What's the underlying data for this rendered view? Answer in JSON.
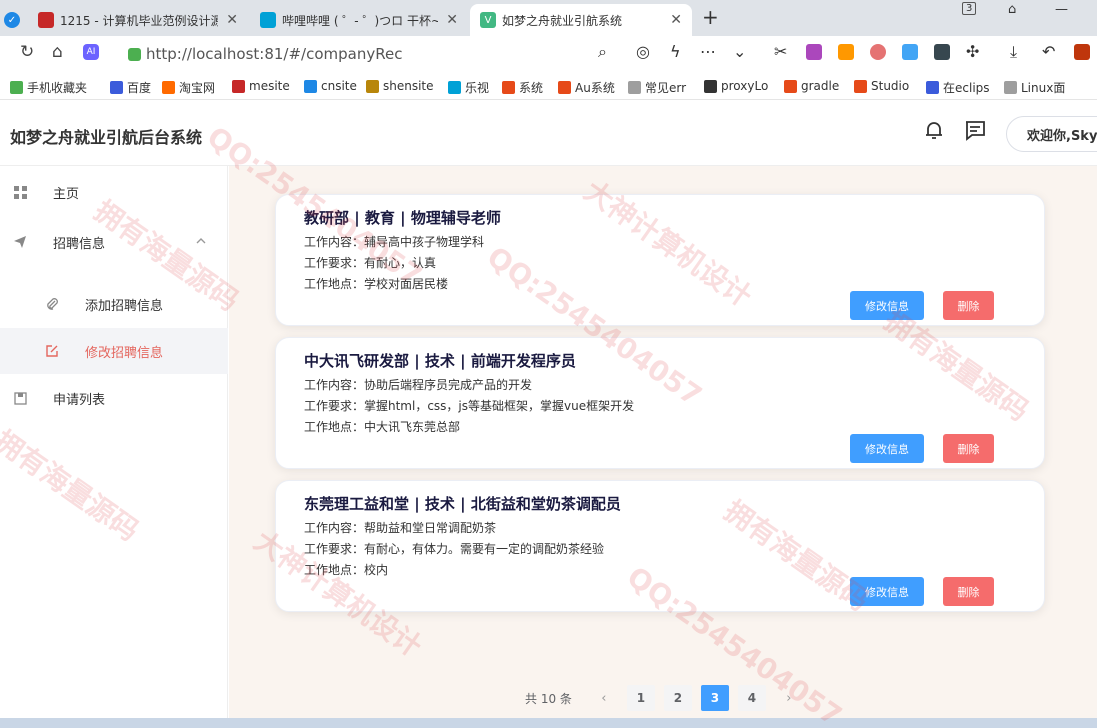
{
  "browser": {
    "tabs": [
      {
        "title": "1215 - 计算机毕业范例设计源",
        "color": "#c62828"
      },
      {
        "title": "哔哩哔哩 ( ゜- ゜)つロ 干杯~-",
        "color": "#00a1d6"
      },
      {
        "title": "如梦之舟就业引航系统",
        "color": "#42b883"
      }
    ],
    "tab_badge": "3",
    "url": "http://localhost:81/#/companyRec",
    "bookmarks": [
      {
        "label": "手机收藏夹",
        "color": "#4caf50"
      },
      {
        "label": "百度",
        "color": "#3b5bdb"
      },
      {
        "label": "淘宝网",
        "color": "#ff6a00"
      },
      {
        "label": "mesite",
        "color": "#c62828"
      },
      {
        "label": "cnsite",
        "color": "#1e88e5"
      },
      {
        "label": "shensite",
        "color": "#b8860b"
      },
      {
        "label": "乐视",
        "color": "#00a1d6"
      },
      {
        "label": "系统",
        "color": "#e64a19"
      },
      {
        "label": "Au系统",
        "color": "#e64a19"
      },
      {
        "label": "常见err",
        "color": "#9e9e9e"
      },
      {
        "label": "proxyLo",
        "color": "#333333"
      },
      {
        "label": "gradle",
        "color": "#e64a19"
      },
      {
        "label": "Studio",
        "color": "#e64a19"
      },
      {
        "label": "在eclips",
        "color": "#3b5bdb"
      },
      {
        "label": "Linux面",
        "color": "#9e9e9e"
      }
    ]
  },
  "app": {
    "title": "如梦之舟就业引航后台系统",
    "welcome": "欢迎你,Sky",
    "accent": "#e4665e"
  },
  "sidebar": {
    "items": [
      {
        "label": "主页",
        "icon": "grid-icon"
      },
      {
        "label": "招聘信息",
        "icon": "send-icon"
      },
      {
        "label": "添加招聘信息",
        "icon": "paperclip-icon"
      },
      {
        "label": "修改招聘信息",
        "icon": "edit-icon"
      },
      {
        "label": "申请列表",
        "icon": "save-icon"
      }
    ]
  },
  "jobs": [
    {
      "title": "教研部 | 教育 | 物理辅导老师",
      "content": "工作内容：辅导高中孩子物理学科",
      "requirement": "工作要求：有耐心，认真",
      "location": "工作地点：学校对面居民楼"
    },
    {
      "title": "中大讯飞研发部 | 技术 | 前端开发程序员",
      "content": "工作内容：协助后端程序员完成产品的开发",
      "requirement": "工作要求：掌握html，css，js等基础框架，掌握vue框架开发",
      "location": "工作地点：中大讯飞东莞总部"
    },
    {
      "title": "东莞理工益和堂 | 技术 | 北街益和堂奶茶调配员",
      "content": "工作内容：帮助益和堂日常调配奶茶",
      "requirement": "工作要求：有耐心，有体力。需要有一定的调配奶茶经验",
      "location": "工作地点：校内"
    }
  ],
  "buttons": {
    "edit": "修改信息",
    "delete": "删除"
  },
  "pagination": {
    "total": "共 10 条",
    "prev": "‹",
    "next": "›",
    "pages": [
      "1",
      "2",
      "3",
      "4"
    ],
    "current": "3"
  },
  "watermarks": [
    "大神计算机设计",
    "拥有海量源码",
    "QQ:2545404057"
  ]
}
